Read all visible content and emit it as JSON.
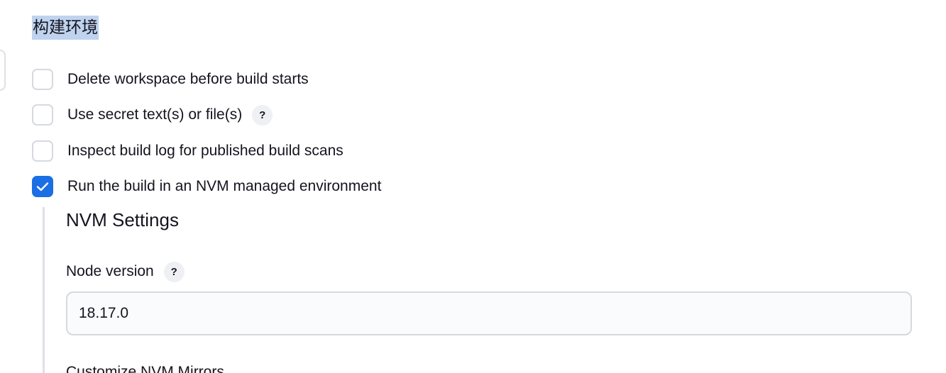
{
  "section": {
    "title": "构建环境"
  },
  "options": [
    {
      "label": "Delete workspace before build starts",
      "checked": false,
      "has_help": false
    },
    {
      "label": "Use secret text(s) or file(s)",
      "checked": false,
      "has_help": true
    },
    {
      "label": "Inspect build log for published build scans",
      "checked": false,
      "has_help": false
    },
    {
      "label": "Run the build in an NVM managed environment",
      "checked": true,
      "has_help": false
    }
  ],
  "help_glyph": "?",
  "nvm": {
    "title": "NVM Settings",
    "node_version": {
      "label": "Node version",
      "value": "18.17.0"
    },
    "mirrors_label": "Customize NVM Mirrors"
  },
  "colors": {
    "accent": "#1a6fe4",
    "selection_highlight": "#bfd3ef",
    "border": "#d6d9df"
  },
  "icons": {
    "checkmark": "check-icon",
    "help": "help-icon"
  }
}
